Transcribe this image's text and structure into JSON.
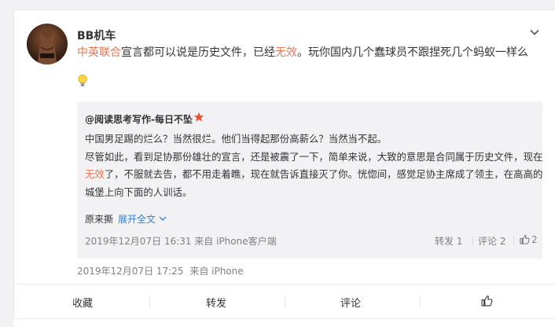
{
  "post": {
    "author": "BB机车",
    "text_parts": {
      "topic": "中英联合",
      "middle": "宣言都可以说是历史文件，已经",
      "highlight": "无效",
      "end": "。玩你国内几个蠢球员不跟捏死几个蚂蚁一样么"
    },
    "timestamp": "2019年12月07日 17:25",
    "source": "来自 iPhone"
  },
  "repost": {
    "author": "@阅读思考写作-每日不坠",
    "lines": [
      "中国男足踢的烂么？当然很烂。他们当得起那份高薪么？当然当不起。",
      "尽管如此，看到足协那份雄壮的宣言，还是被震了一下，简单来说，大致的意思是合同属于历史文件，现在"
    ],
    "line3": {
      "highlight": "无效",
      "rest": "了，不服就去告，都不用走着瞧，现在就告诉直接灭了你。恍惚间，感觉足协主席成了领主，在高高的"
    },
    "line4": "城堡上向下面的人训话。",
    "tail": "原来撕",
    "expand_label": "展开全文",
    "expand_icon": "chevron-down",
    "meta": "2019年12月07日 16:31 来自 iPhone客户端",
    "repost_label": "转发 1",
    "comment_label": "评论 2",
    "like_count": "2"
  },
  "actions": {
    "favorite": "收藏",
    "repost": "转发",
    "comment": "评论",
    "like_icon": "thumbs-up"
  },
  "colors": {
    "highlight": "#eb7350",
    "link": "#2f7fd6",
    "meta": "#808080",
    "repost_bg": "#f2f2f5"
  }
}
